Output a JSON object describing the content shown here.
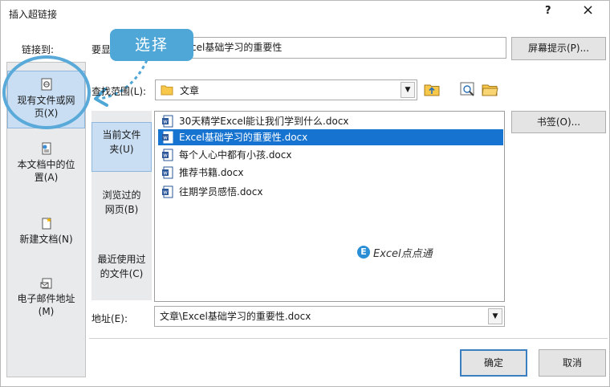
{
  "window": {
    "title": "插入超链接",
    "help_label": "?",
    "close_label": "×"
  },
  "link_to": {
    "label": "链接到:",
    "items": [
      {
        "label_line1": "现有文件或网",
        "label_line2": "页(X)",
        "icon": "web-page-icon",
        "selected": true
      },
      {
        "label_line1": "本文档中的位",
        "label_line2": "置(A)",
        "icon": "document-place-icon",
        "selected": false
      },
      {
        "label_line1": "新建文档(N)",
        "label_line2": "",
        "icon": "new-document-icon",
        "selected": false
      },
      {
        "label_line1": "电子邮件地址",
        "label_line2": "(M)",
        "icon": "email-address-icon",
        "selected": false
      }
    ]
  },
  "display_text": {
    "label": "要显",
    "value": "cel基础学习的重要性"
  },
  "annotation": {
    "bubble_text": "选择",
    "color": "#4fa7d8"
  },
  "screentip_button": "屏幕提示(P)...",
  "look_in": {
    "label": "查找范围(L):",
    "value": "文章",
    "tools": [
      "up-folder-icon",
      "browse-web-icon",
      "browse-file-icon"
    ]
  },
  "subnav": [
    {
      "line1": "当前文件",
      "line2": "夹(U)",
      "selected": true
    },
    {
      "line1": "浏览过的",
      "line2": "网页(B)",
      "selected": false
    },
    {
      "line1": "最近使用过",
      "line2": "的文件(C)",
      "selected": false
    }
  ],
  "files": [
    {
      "name": "30天精学Excel能让我们学到什么.docx",
      "selected": false
    },
    {
      "name": "Excel基础学习的重要性.docx",
      "selected": true
    },
    {
      "name": "每个人心中都有小孩.docx",
      "selected": false
    },
    {
      "name": "推荐书籍.docx",
      "selected": false
    },
    {
      "name": "往期学员感悟.docx",
      "selected": false
    }
  ],
  "bookmark_button": "书签(O)...",
  "watermark": {
    "logo_letter": "E",
    "text": "Excel点点通"
  },
  "address": {
    "label": "地址(E):",
    "value": "文章\\Excel基础学习的重要性.docx"
  },
  "ok_button": "确定",
  "cancel_button": "取消",
  "colors": {
    "selection": "#1773d0",
    "nav_selected": "#c9def3",
    "ok_border": "#3c7fc1"
  }
}
